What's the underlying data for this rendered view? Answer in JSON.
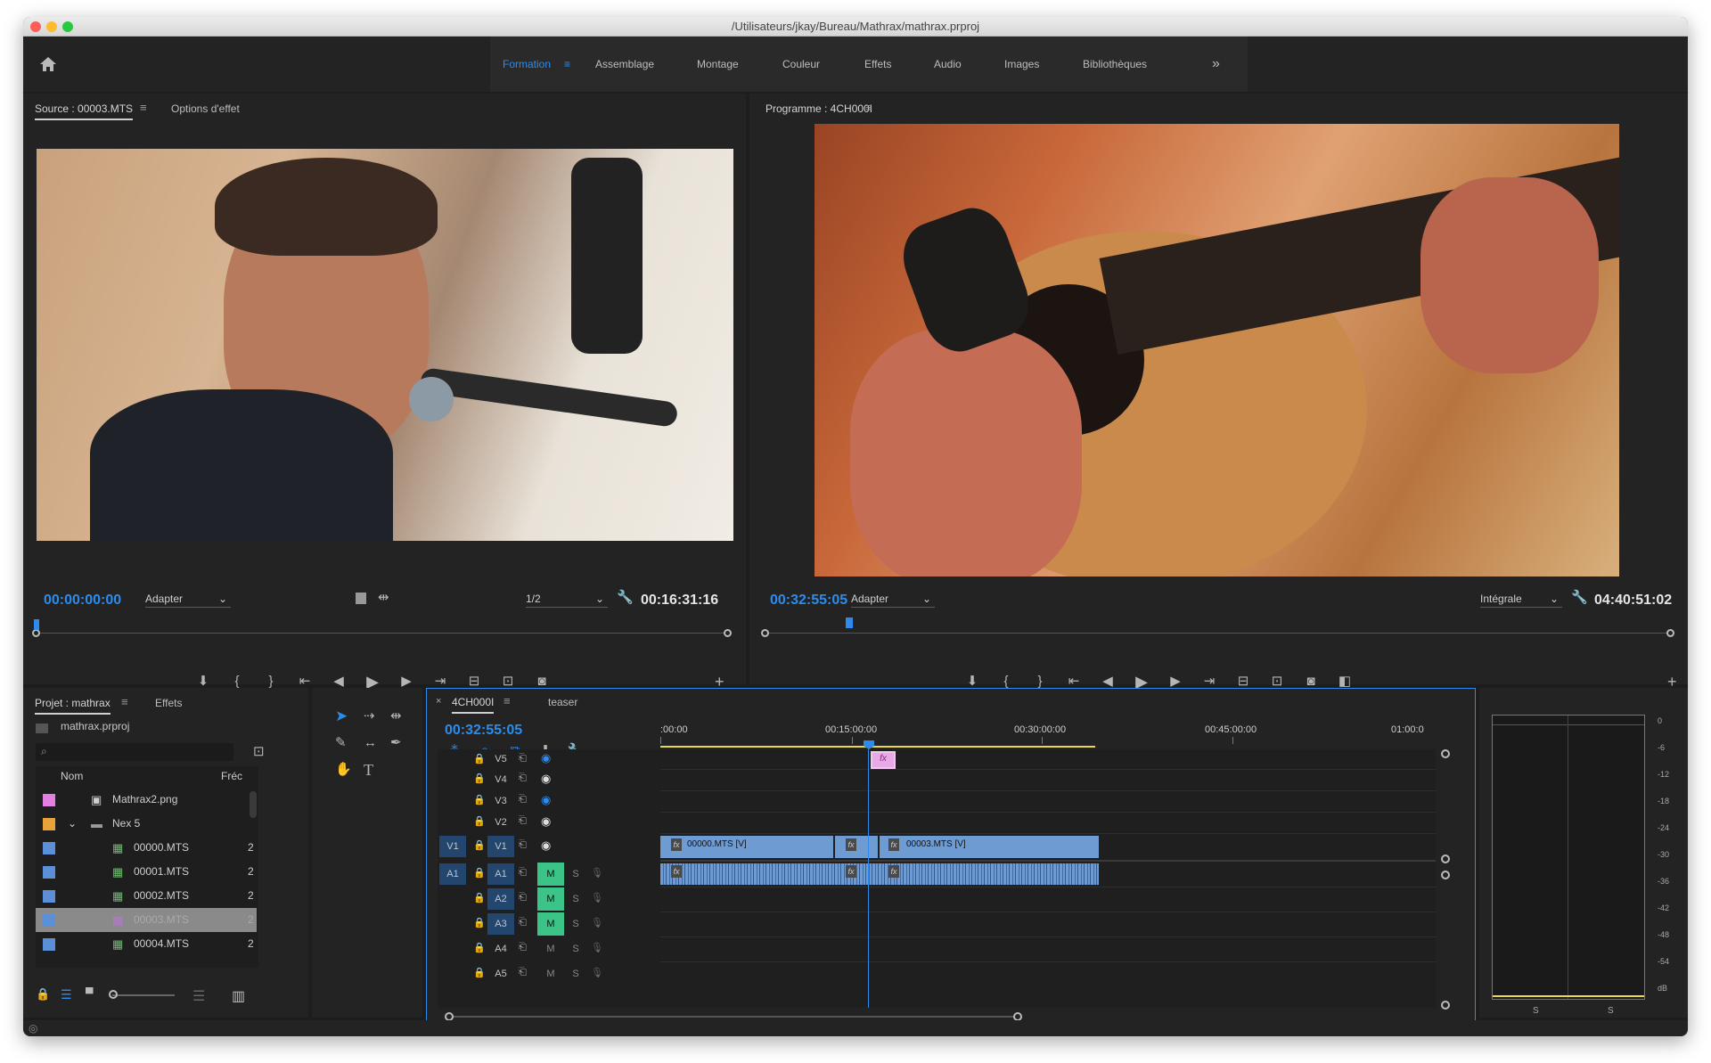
{
  "window": {
    "title": "/Utilisateurs/jkay/Bureau/Mathrax/mathrax.prproj"
  },
  "workspaces": [
    {
      "label": "Formation",
      "active": true
    },
    {
      "label": "Assemblage",
      "active": false
    },
    {
      "label": "Montage",
      "active": false
    },
    {
      "label": "Couleur",
      "active": false
    },
    {
      "label": "Effets",
      "active": false
    },
    {
      "label": "Audio",
      "active": false
    },
    {
      "label": "Images",
      "active": false
    },
    {
      "label": "Bibliothèques",
      "active": false
    }
  ],
  "more_workspaces": "»",
  "source": {
    "tab": "Source : 00003.MTS",
    "tab2": "Options d'effet",
    "timecode": "00:00:00:00",
    "fit": "Adapter",
    "resolution": "1/2",
    "duration": "00:16:31:16"
  },
  "program": {
    "tab": "Programme : 4CH000I",
    "timecode": "00:32:55:05",
    "fit": "Adapter",
    "resolution": "Intégrale",
    "duration": "04:40:51:02"
  },
  "project": {
    "tab": "Projet : mathrax",
    "tab2": "Effets",
    "file": "mathrax.prproj",
    "col_name": "Nom",
    "col_rate": "Fréc",
    "items": [
      {
        "name": "Mathrax2.png",
        "color": "#e27fe0",
        "rate": "",
        "type": "image"
      },
      {
        "name": "Nex 5",
        "color": "#e8a23a",
        "rate": "",
        "type": "folder"
      },
      {
        "name": "00000.MTS",
        "color": "#5b8fd8",
        "rate": "2",
        "type": "clip"
      },
      {
        "name": "00001.MTS",
        "color": "#5b8fd8",
        "rate": "2",
        "type": "clip"
      },
      {
        "name": "00002.MTS",
        "color": "#5b8fd8",
        "rate": "2",
        "type": "clip"
      },
      {
        "name": "00003.MTS",
        "color": "#5b8fd8",
        "rate": "2",
        "type": "clip",
        "selected": true
      },
      {
        "name": "00004.MTS",
        "color": "#5b8fd8",
        "rate": "2",
        "type": "clip"
      }
    ]
  },
  "timeline": {
    "tab": "4CH000I",
    "tab2": "teaser",
    "timecode": "00:32:55:05",
    "ruler": [
      ":00:00",
      "00:15:00:00",
      "00:30:00:00",
      "00:45:00:00",
      "01:00:0"
    ],
    "video_tracks": [
      "V5",
      "V4",
      "V3",
      "V2",
      "V1"
    ],
    "audio_tracks": [
      "A1",
      "A2",
      "A3",
      "A4",
      "A5"
    ],
    "source_patch_v": "V1",
    "source_patch_a": "A1",
    "mute_label": "M",
    "solo_label": "S",
    "fx_label": "fx",
    "clips": [
      {
        "label": "00000.MTS [V]"
      },
      {
        "label": "00003.MTS [V]"
      }
    ]
  },
  "meter": {
    "scale": [
      "0",
      "-6",
      "-12",
      "-18",
      "-24",
      "-30",
      "-36",
      "-42",
      "-48",
      "-54",
      "dB"
    ],
    "solo": [
      "S",
      "S"
    ]
  },
  "colors": {
    "accent": "#2d8ceb",
    "clip": "#6f9bd3",
    "mute_on": "#3cc488",
    "playhead": "#2d8ceb"
  }
}
